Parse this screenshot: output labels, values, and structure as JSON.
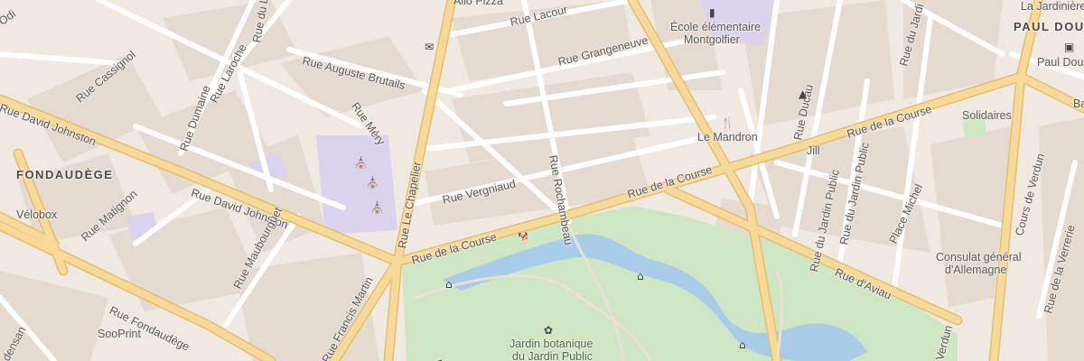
{
  "map": {
    "districts": {
      "fondaudege": "FONDAUDÈGE",
      "paul_doumer": "PAUL DOU"
    },
    "streets": {
      "rue_lacour": "Rue Lacour",
      "rue_auguste_brutails": "Rue Auguste Brutails",
      "rue_grangeneuve": "Rue Grangeneuve",
      "rue_cassignol": "Rue Cassignol",
      "rue_laroche": "Rue Laroche",
      "rue_dumaine": "Rue Dumaine",
      "rue_du_l": "Rue du L",
      "rue_mery": "Rue Méry",
      "rue_david_johnston_1": "Rue David Johnston",
      "rue_david_johnston_2": "Rue David Johnston",
      "rue_matignon": "Rue Matignon",
      "rue_le_chapelier": "Rue Le Chapelier",
      "rue_vergniaud": "Rue Vergniaud",
      "rue_rochambeau": "Rue Rochambeau",
      "rue_de_la_course_1": "Rue de la Course",
      "rue_de_la_course_2": "Rue de la Course",
      "rue_de_la_course_3": "Rue de la Course",
      "rue_maubourguet": "Rue Maubourguet",
      "rue_fondaudege": "Rue Fondaudège",
      "rue_francis_martin": "Rue Francis Martin",
      "rue_ducau": "Rue Ducau",
      "rue_du_jardin_public": "Rue du Jardin Public",
      "rue_du_jardin_public_2": "Rue du Jardin Public",
      "rue_du_jardi": "Rue du Jardi",
      "place_michel": "Place Michel",
      "rue_daviau": "Rue d'Aviau",
      "cours_de_verdun": "Cours de Verdun",
      "rue_de_la_verrerie": "Rue de la Verrerie",
      "densan": "densan",
      "verdun_cut": "Verdun",
      "rue_cut": "Ru",
      "odi": "Odi"
    },
    "pois": {
      "allo_pizza": "Allo Pizza",
      "ecole": "École élémentaire",
      "ecole_2": "Montgolfier",
      "le_mandron": "Le Mandron",
      "jill": "Jill",
      "solidaires": "Solidaires",
      "consulat": "Consulat général",
      "consulat_2": "d'Allemagne",
      "velobox": "Vélobox",
      "sooprint": "SooPrint",
      "jardin": "Jardin botanique",
      "jardin_2": "du Jardin Public",
      "la_jardiniere": "La Jardinière",
      "paul_doumer_stop": "Paul Dou",
      "ba": "Ba"
    },
    "icons": {
      "school": "school-icon",
      "restaurant": "restaurant-icon",
      "post": "post-office-icon",
      "church": "church-icon",
      "museum": "museum-icon",
      "garden": "garden-icon",
      "dog_park": "dog-park-icon",
      "bus": "bus-stop-icon"
    },
    "colors": {
      "background": "#efe9e1",
      "block": "#e3d9ce",
      "major_road": "#f7d99a",
      "major_road_casing": "#e6be6e",
      "minor_road": "#ffffff",
      "park": "#cfe6c4",
      "water": "#a9cde8",
      "school_area": "#d9d3ee"
    }
  }
}
